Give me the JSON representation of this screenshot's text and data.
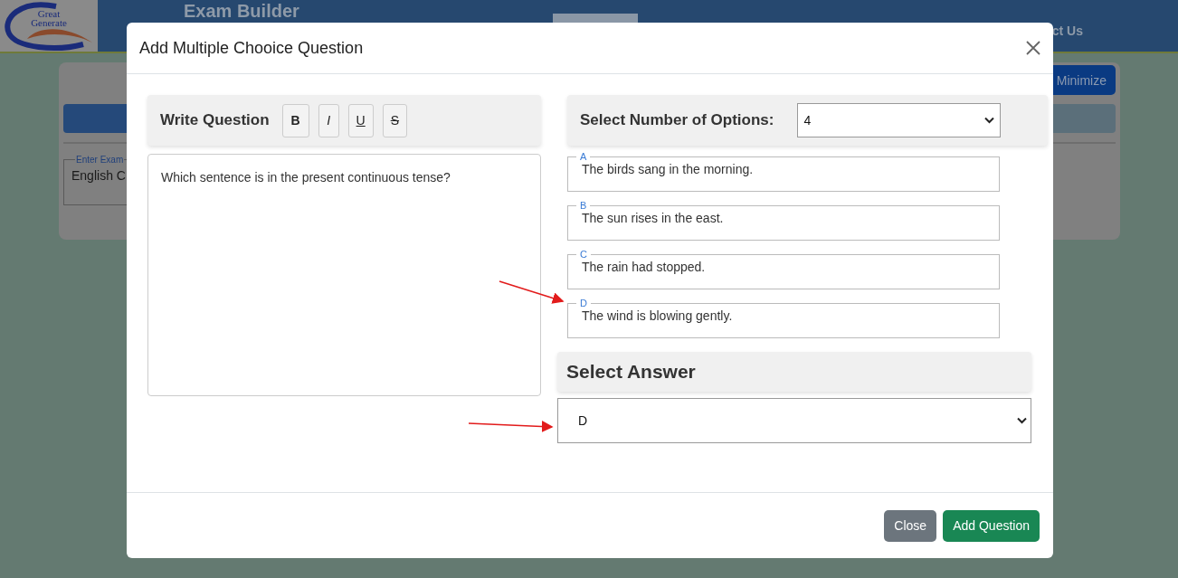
{
  "header": {
    "logo_lines": [
      "Great",
      "Generate"
    ],
    "title": "Exam Builder",
    "nav_link": "ct Us"
  },
  "background_card": {
    "minimize_button": "Minimize",
    "exam_field": {
      "legend": "Enter Exam",
      "value": "English C"
    }
  },
  "modal": {
    "title": "Add Multiple Chooice Question",
    "question_panel": {
      "heading": "Write Question",
      "format_buttons": [
        {
          "label": "B",
          "kind": "bold"
        },
        {
          "label": "I",
          "kind": "italic"
        },
        {
          "label": "U",
          "kind": "underline"
        },
        {
          "label": "S",
          "kind": "strike"
        }
      ],
      "text": "Which sentence is in the present continuous tense?"
    },
    "options_panel": {
      "heading": "Select Number of Options:",
      "count_value": "4",
      "options": [
        {
          "letter": "A",
          "text": "The birds sang in the morning."
        },
        {
          "letter": "B",
          "text": "The sun rises in the east."
        },
        {
          "letter": "C",
          "text": "The rain had stopped."
        },
        {
          "letter": "D",
          "text": "The wind is blowing gently."
        }
      ]
    },
    "answer": {
      "heading": "Select Answer",
      "value": "D"
    },
    "buttons": [
      {
        "label": "Close",
        "kind": "secondary"
      },
      {
        "label": "Add Question",
        "kind": "primary"
      }
    ]
  }
}
